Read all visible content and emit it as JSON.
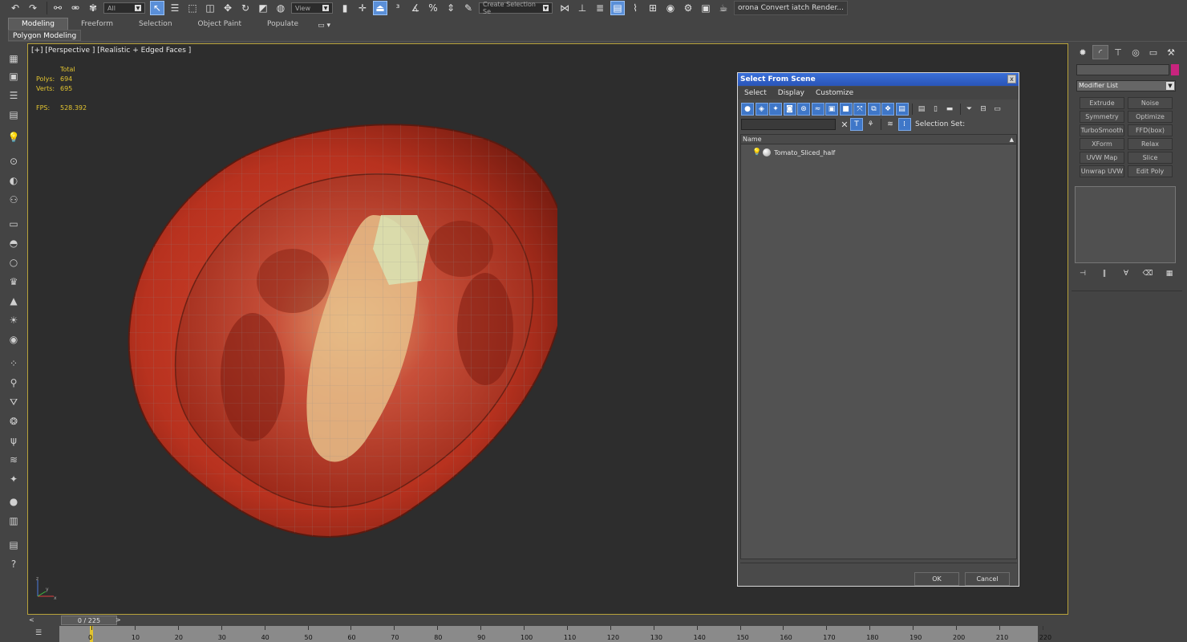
{
  "main_toolbar": {
    "selection_filter": "All",
    "reference_coord": "View",
    "named_selection_placeholder": "Create Selection Se",
    "corona_text": "orona Convert iatch Render..."
  },
  "ribbon": {
    "tabs": [
      "Modeling",
      "Freeform",
      "Selection",
      "Object Paint",
      "Populate"
    ],
    "active_tab": "Modeling",
    "panel_label": "Polygon Modeling"
  },
  "viewport": {
    "label": "[+] [Perspective ] [Realistic + Edged Faces ]",
    "stats": {
      "total_label": "Total",
      "polys_label": "Polys:",
      "polys_value": "694",
      "verts_label": "Verts:",
      "verts_value": "695",
      "fps_label": "FPS:",
      "fps_value": "528.392"
    },
    "axis": {
      "x": "x",
      "y": "y",
      "z": "z"
    },
    "border_color": "#b8a23a"
  },
  "command_panel": {
    "modifier_list": "Modifier List",
    "object_color": "#c8247e",
    "modifiers": [
      "Extrude",
      "Noise",
      "Symmetry",
      "Optimize",
      "TurboSmooth",
      "FFD(box)",
      "XForm",
      "Relax",
      "UVW Map",
      "Slice",
      "Unwrap UVW",
      "Edit Poly"
    ]
  },
  "dialog": {
    "title": "Select From Scene",
    "close": "x",
    "menu": [
      "Select",
      "Display",
      "Customize"
    ],
    "selection_set_label": "Selection Set:",
    "column_header": "Name",
    "items": [
      "Tomato_Sliced_half"
    ],
    "ok": "OK",
    "cancel": "Cancel",
    "title_bar_color": "#2a55b8"
  },
  "timeline": {
    "frame_display": "0 / 225",
    "ticks": [
      "0",
      "10",
      "20",
      "30",
      "40",
      "50",
      "60",
      "70",
      "80",
      "90",
      "100",
      "110",
      "120",
      "130",
      "140",
      "150",
      "160",
      "170",
      "180",
      "190",
      "200",
      "210",
      "220"
    ]
  }
}
